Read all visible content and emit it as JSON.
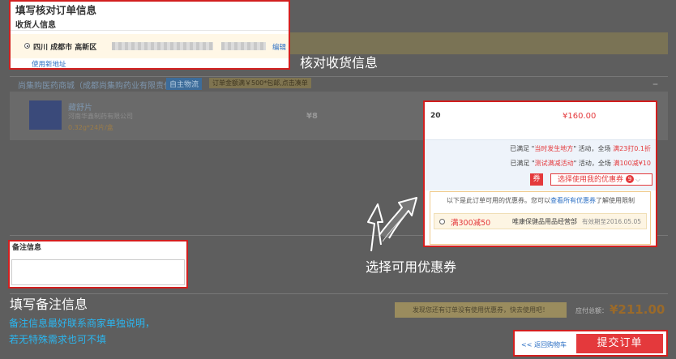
{
  "address_card": {
    "title": "填写核对订单信息",
    "section": "收货人信息",
    "address": "四川 成都市 高新区",
    "edit_label": "编辑",
    "new_address_label": "使用新地址"
  },
  "callouts": {
    "address": "核对收货信息",
    "coupon": "选择可用优惠券",
    "remark": "填写备注信息",
    "remark_tip_1": "备注信息最好联系商家单独说明，",
    "remark_tip_2": "若无特殊需求也可不填"
  },
  "store": {
    "name": "尚集购医药商城（成都尚集购药业有限责任公司）",
    "tag": "自主物流",
    "free_ship": "订单金额满￥500*包邮,点击凑单",
    "collapse": "–"
  },
  "product": {
    "name": "藏舒片",
    "maker": "河南华鑫制药有限公司",
    "spec": "0.32g*24片/盒",
    "price": "¥8"
  },
  "coupon_card": {
    "qty": "20",
    "subtotal": "¥160.00",
    "promo1_prefix": "已满足 \"",
    "promo1_name": "当时发生地方",
    "promo1_suffix": "\" 活动，全场",
    "promo1_detail": "满23打0.1折",
    "promo2_prefix": "已满足 \"",
    "promo2_name": "测试满减活动",
    "promo2_suffix": "\" 活动，全场",
    "promo2_detail": "满100减¥10",
    "tag": "券",
    "select_label": "选择使用我的优惠券",
    "select_count": "9",
    "hint_prefix": "以下是此订单可用的优惠券。您可以",
    "hint_link": "查看所有优惠券",
    "hint_suffix": "了解使用限制",
    "item_value": "满300减50",
    "item_shop": "唯康保健品用品经营部",
    "item_expiry": "有效期至2016.05.05"
  },
  "remark_card": {
    "title": "备注信息"
  },
  "footer": {
    "notice": "发现您还有订单没有使用优惠券，快去使用吧！",
    "total_label": "应付总额：",
    "total_amount": "¥211.00",
    "back_label": "<< 返回购物车",
    "submit_label": "提交订单"
  },
  "colors": {
    "accent": "#e4393c",
    "callout_border": "#d21f1f",
    "caption_blue": "#2ab6f0",
    "link": "#2b6fc4"
  }
}
